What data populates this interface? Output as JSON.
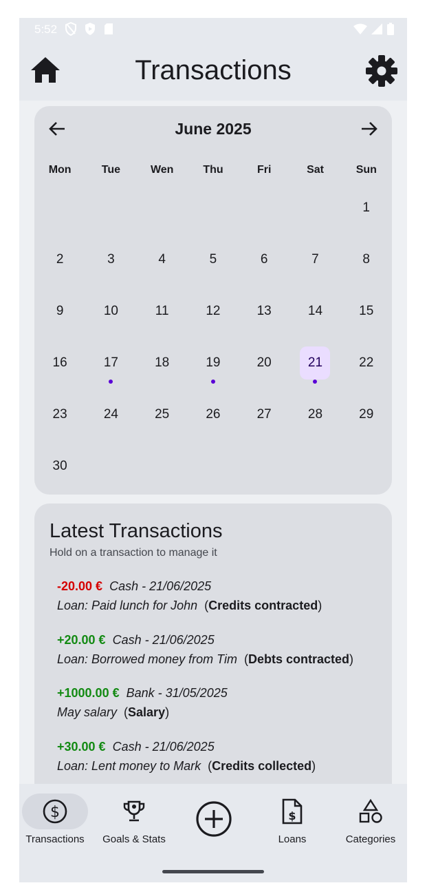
{
  "status_bar": {
    "time": "5:52"
  },
  "header": {
    "title": "Transactions"
  },
  "calendar": {
    "month_label": "June 2025",
    "weekdays": [
      "Mon",
      "Tue",
      "Wen",
      "Thu",
      "Fri",
      "Sat",
      "Sun"
    ],
    "days": [
      "",
      "",
      "",
      "",
      "",
      "",
      "1",
      "2",
      "3",
      "4",
      "5",
      "6",
      "7",
      "8",
      "9",
      "10",
      "11",
      "12",
      "13",
      "14",
      "15",
      "16",
      "17",
      "18",
      "19",
      "20",
      "21",
      "22",
      "23",
      "24",
      "25",
      "26",
      "27",
      "28",
      "29",
      "30"
    ],
    "selected_day": "21",
    "days_with_transactions": [
      "17",
      "19",
      "21"
    ]
  },
  "transactions": {
    "title": "Latest Transactions",
    "hint": "Hold on a transaction to manage it",
    "items": [
      {
        "amount": "-20.00 €",
        "meta": "Cash - 21/06/2025",
        "description": "Loan: Paid lunch for John",
        "category": "Credits contracted",
        "sign": "neg"
      },
      {
        "amount": "+20.00 €",
        "meta": "Cash - 21/06/2025",
        "description": "Loan: Borrowed money from Tim",
        "category": "Debts contracted",
        "sign": "pos"
      },
      {
        "amount": "+1000.00 €",
        "meta": "Bank - 31/05/2025",
        "description": "May salary",
        "category": "Salary",
        "sign": "pos"
      },
      {
        "amount": "+30.00 €",
        "meta": "Cash - 21/06/2025",
        "description": "Loan: Lent money to Mark",
        "category": "Credits collected",
        "sign": "pos"
      }
    ]
  },
  "bottom_nav": {
    "items": [
      {
        "label": "Transactions",
        "icon": "dollar-circle-icon"
      },
      {
        "label": "Goals & Stats",
        "icon": "trophy-icon"
      },
      {
        "label": "",
        "icon": "add-circle-icon"
      },
      {
        "label": "Loans",
        "icon": "invoice-dollar-icon"
      },
      {
        "label": "Categories",
        "icon": "shapes-icon"
      }
    ]
  },
  "colors": {
    "accent": "#5a00d6",
    "negative_amount": "#d50000",
    "positive_amount": "#138a13",
    "selected_day_bg": "#eaddff"
  }
}
